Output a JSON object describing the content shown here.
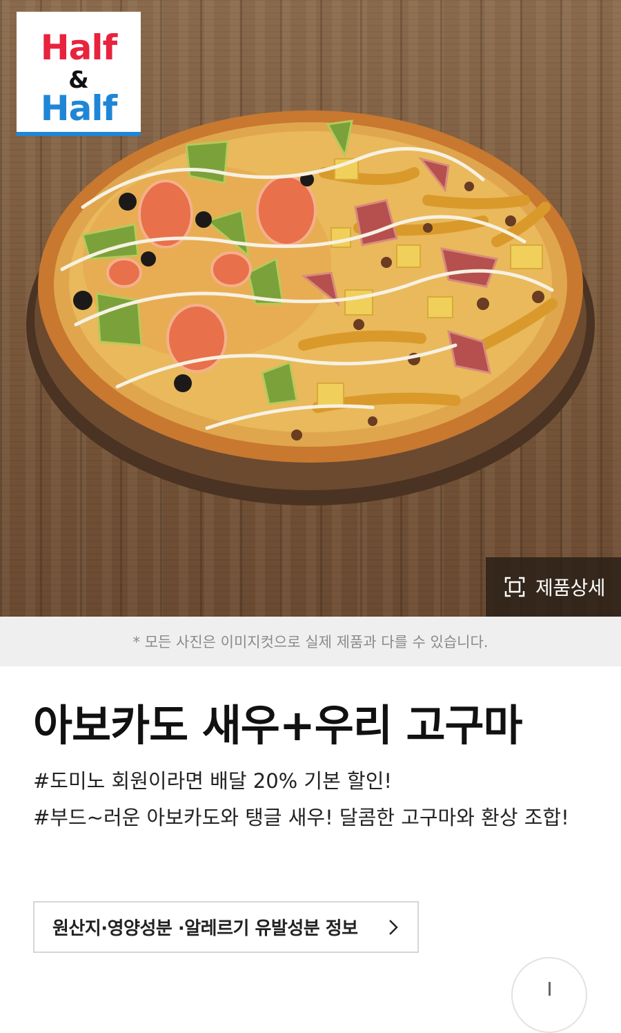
{
  "badge": {
    "line1": "Half",
    "line2": "&",
    "line3": "Half"
  },
  "hero": {
    "image": "pizza-photo",
    "detail_button": {
      "icon": "expand-frame-icon",
      "label": "제품상세"
    }
  },
  "disclaimer": "* 모든 사진은 이미지컷으로 실제 제품과 다를 수 있습니다.",
  "product": {
    "title": "아보카도 새우+우리 고구마",
    "tags": [
      "#도미노 회원이라면 배달 20% 기본 할인!",
      "#부드~러운 아보카도와 탱글 새우! 달콤한 고구마와 환상 조합!"
    ]
  },
  "origin_button": {
    "label": "원산지·영양성분 ·알레르기 유발성분 정보",
    "icon": "chevron-right-icon"
  },
  "colors": {
    "badge_red": "#e8233e",
    "badge_blue": "#1f86d6",
    "disclaimer_bg": "#efefef"
  }
}
